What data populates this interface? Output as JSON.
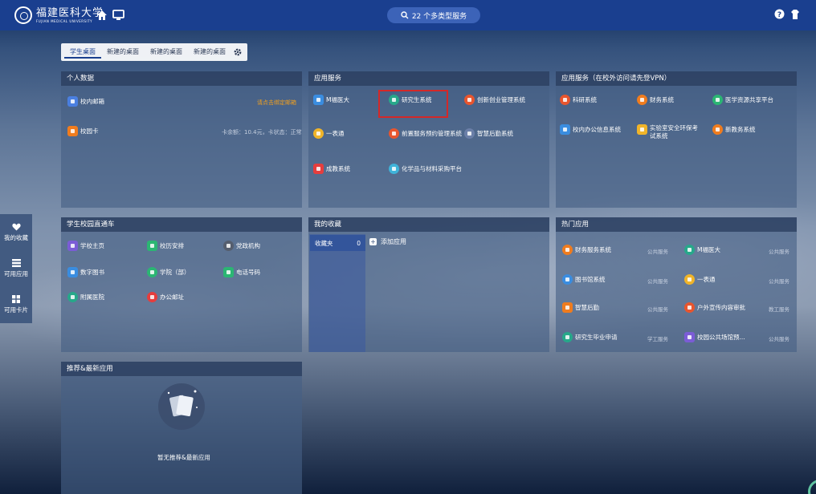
{
  "header": {
    "logo_cn": "福建医科大学",
    "logo_en": "FUJIAN MEDICAL UNIVERSITY",
    "search_text": "22 个多类型服务"
  },
  "tabs": [
    {
      "label": "学生桌面",
      "active": true
    },
    {
      "label": "新建的桌面",
      "active": false
    },
    {
      "label": "新建的桌面",
      "active": false
    },
    {
      "label": "新建的桌面",
      "active": false
    }
  ],
  "side_nav": [
    {
      "label": "我的收藏",
      "icon": "heart-icon"
    },
    {
      "label": "可用应用",
      "icon": "list-icon"
    },
    {
      "label": "可用卡片",
      "icon": "grid-icon"
    }
  ],
  "personal": {
    "title": "个人数据",
    "mail_label": "校内邮箱",
    "mail_note": "请点击绑定邮箱",
    "card_label": "校园卡",
    "card_note": "卡余额：10.4元，卡状态：正常"
  },
  "app_service": {
    "title": "应用服务",
    "items": [
      {
        "label": "M福医大",
        "color": "#3a8de0",
        "shape": "square"
      },
      {
        "label": "研究生系统",
        "color": "#27a88a",
        "shape": "round"
      },
      {
        "label": "创新创业管理系统",
        "color": "#e8552e",
        "shape": "round"
      },
      {
        "label": "一表通",
        "color": "#f0b429",
        "shape": "round"
      },
      {
        "label": "前置服务预约管理系统",
        "color": "#e8552e",
        "shape": "round"
      },
      {
        "label": "智慧后勤系统",
        "color": "#6b7fa8",
        "shape": "round"
      },
      {
        "label": "成教系统",
        "color": "#e63d3d",
        "shape": "square"
      },
      {
        "label": "化学品与材料采购平台",
        "color": "#3fb3d9",
        "shape": "round"
      }
    ]
  },
  "vpn_service": {
    "title": "应用服务（在校外访问请先登VPN）",
    "items": [
      {
        "label": "科研系统",
        "color": "#e8552e"
      },
      {
        "label": "财务系统",
        "color": "#f07c1e"
      },
      {
        "label": "医学资源共享平台",
        "color": "#2bb673"
      },
      {
        "label": "校内办公信息系统",
        "color": "#3a8de0"
      },
      {
        "label": "实验室安全环保考试系统",
        "color": "#f0b429"
      },
      {
        "label": "新教务系统",
        "color": "#f07c1e"
      }
    ]
  },
  "direct": {
    "title": "学生校园直通车",
    "items": [
      {
        "label": "学校主页",
        "color": "#7b5cd6"
      },
      {
        "label": "校历安排",
        "color": "#2bb673"
      },
      {
        "label": "党政机构",
        "color": "#555e6e"
      },
      {
        "label": "数字图书",
        "color": "#3a8de0"
      },
      {
        "label": "学院（部）",
        "color": "#2bb673"
      },
      {
        "label": "电话号码",
        "color": "#2bb673"
      },
      {
        "label": "附属医院",
        "color": "#27a88a"
      },
      {
        "label": "办公邮址",
        "color": "#e63d3d"
      }
    ]
  },
  "favorites": {
    "title": "我的收藏",
    "folder_label": "收藏夹",
    "folder_count": "0",
    "add_label": "添加应用"
  },
  "hot": {
    "title": "热门应用",
    "items": [
      {
        "label": "财务服务系统",
        "category": "公共服务",
        "color": "#f07c1e"
      },
      {
        "label": "M福医大",
        "category": "公共服务",
        "color": "#27a88a"
      },
      {
        "label": "图书馆系统",
        "category": "公共服务",
        "color": "#3a8de0"
      },
      {
        "label": "一表通",
        "category": "公共服务",
        "color": "#f0b429"
      },
      {
        "label": "智慧后勤",
        "category": "公共服务",
        "color": "#f07c1e"
      },
      {
        "label": "户外宣传内容审批",
        "category": "教工服务",
        "color": "#e8552e"
      },
      {
        "label": "研究生毕业申请",
        "category": "学工服务",
        "color": "#27a88a"
      },
      {
        "label": "校园公共场馆预...",
        "category": "公共服务",
        "color": "#7b5cd6"
      }
    ]
  },
  "recommend": {
    "title": "推荐&最新应用",
    "empty_text": "暂无推荐&最新应用"
  }
}
